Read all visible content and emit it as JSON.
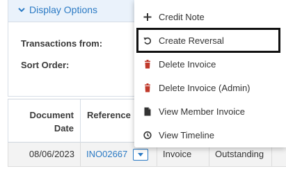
{
  "display_options": {
    "title": "Display Options",
    "transactions_from_label": "Transactions from:",
    "sort_order_label": "Sort Order:"
  },
  "table": {
    "headers": {
      "document_date": [
        "Document",
        "Date"
      ],
      "reference": "Reference"
    },
    "row": {
      "date": "08/06/2023",
      "reference": "INO02667",
      "type": "Invoice",
      "status": "Outstanding"
    }
  },
  "menu": {
    "items": [
      {
        "label": "Credit Note",
        "icon": "plus-icon"
      },
      {
        "label": "Create Reversal",
        "icon": "undo-icon"
      },
      {
        "label": "Delete Invoice",
        "icon": "trash-icon"
      },
      {
        "label": "Delete Invoice (Admin)",
        "icon": "trash-icon"
      },
      {
        "label": "View Member Invoice",
        "icon": "document-icon"
      },
      {
        "label": "View Timeline",
        "icon": "clock-icon"
      }
    ]
  },
  "colors": {
    "accent": "#2b7ac4",
    "header_bg": "#eaf2fb",
    "danger": "#c0392b"
  }
}
